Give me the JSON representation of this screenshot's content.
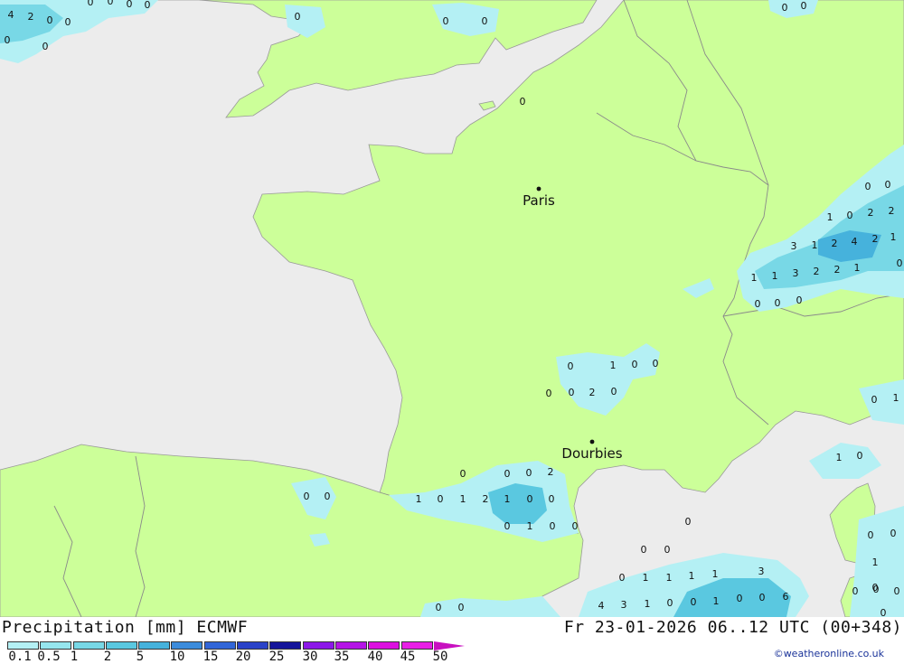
{
  "footer": {
    "title": "Precipitation [mm] ECMWF",
    "datetime": "Fr 23-01-2026 06..12 UTC (00+348)",
    "credit": "©weatheronline.co.uk"
  },
  "legend": {
    "ticks": [
      "0.1",
      "0.5",
      "1",
      "2",
      "5",
      "10",
      "15",
      "20",
      "25",
      "30",
      "35",
      "40",
      "45",
      "50"
    ],
    "colors": [
      "#b4f0f4",
      "#96e6ee",
      "#78d8e6",
      "#5ac8e0",
      "#46b2dc",
      "#3c8cdc",
      "#3266d8",
      "#2a42c8",
      "#14149a",
      "#8c18e8",
      "#b414e6",
      "#dc10e0",
      "#e81ee6",
      "#c810c0"
    ]
  },
  "map": {
    "colors": {
      "sea": "#ececec",
      "land": "#ccff99",
      "border": "#999999",
      "light_rain": "#b4f0f4",
      "moderate_rain": "#5ac8e0"
    },
    "cities": [
      {
        "name": "Paris"
      },
      {
        "name": "Dourbies"
      }
    ],
    "values": [
      "4",
      "2",
      "0",
      "0",
      "0",
      "0",
      "0",
      "0",
      "0",
      "0",
      "0",
      "0",
      "0",
      "0",
      "0",
      "0",
      "0",
      "0",
      "1",
      "0",
      "2",
      "2",
      "3",
      "1",
      "2",
      "4",
      "2",
      "1",
      "1",
      "1",
      "3",
      "2",
      "2",
      "1",
      "0",
      "0",
      "0",
      "0",
      "0",
      "1",
      "0",
      "0",
      "0",
      "0",
      "2",
      "0",
      "0",
      "0",
      "0",
      "2",
      "0",
      "0",
      "1",
      "0",
      "1",
      "2",
      "1",
      "0",
      "0",
      "0",
      "1",
      "0",
      "0",
      "0",
      "0",
      "0",
      "0",
      "1",
      "1",
      "0",
      "0",
      "0",
      "1",
      "0",
      "1",
      "1",
      "1",
      "1",
      "3",
      "4",
      "3",
      "1",
      "0",
      "0",
      "1",
      "0",
      "0",
      "6",
      "0",
      "0",
      "0",
      "0",
      "0",
      "0",
      "0"
    ]
  }
}
